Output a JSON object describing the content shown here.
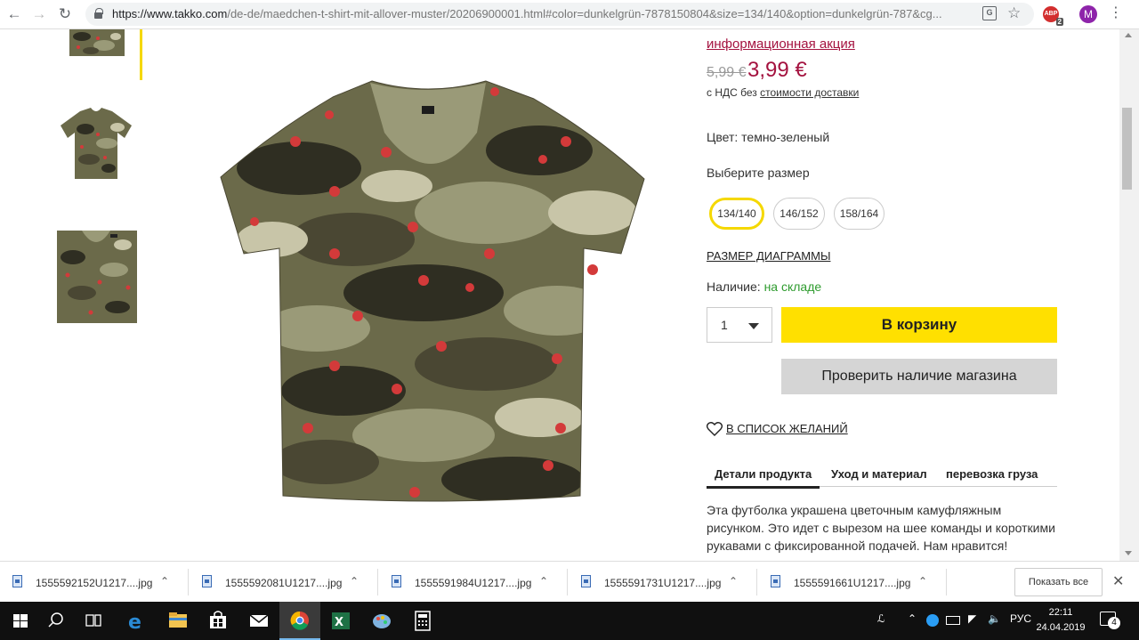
{
  "browser": {
    "url_host": "https://www.takko.com",
    "url_path": "/de-de/maedchen-t-shirt-mit-allover-muster/20206900001.html#color=dunkelgrün-7878150804&size=134/140&option=dunkelgrün-787&cg...",
    "ext_badge": "2",
    "ext_label": "ABP",
    "profile_initial": "M"
  },
  "product": {
    "promo_link": "информационная акция",
    "old_price": "5,99 €",
    "new_price": "3,99 €",
    "vat_prefix": "с НДС без",
    "vat_link": "стоимости доставки",
    "color_line": "Цвет: темно-зеленый",
    "size_title": "Выберите размер",
    "sizes": [
      "134/140",
      "146/152",
      "158/164"
    ],
    "size_chart_link": "РАЗМЕР ДИАГРАММЫ",
    "availability_label": "Наличие:",
    "availability_value": "на складе",
    "quantity": "1",
    "add_to_cart": "В корзину",
    "check_store": "Проверить наличие магазина",
    "wishlist": "В СПИСОК ЖЕЛАНИЙ",
    "tabs": [
      "Детали продукта",
      "Уход и материал",
      "перевозка груза"
    ],
    "description": "Эта футболка украшена цветочным камуфляжным рисунком. Это идет с вырезом на шее команды и короткими рукавами с фиксированной подачей. Нам нравится!"
  },
  "downloads": {
    "files": [
      "1555592152U1217....jpg",
      "1555592081U1217....jpg",
      "1555591984U1217....jpg",
      "1555591731U1217....jpg",
      "1555591661U1217....jpg"
    ],
    "show_all": "Показать все"
  },
  "taskbar": {
    "lang": "РУС",
    "time": "22:11",
    "date": "24.04.2019",
    "notifications": "4"
  },
  "colors": {
    "accent_yellow": "#ffe000",
    "price_red": "#a4123f",
    "stock_green": "#2e9b2e",
    "camo": [
      "#6b6a4a",
      "#9a9a78",
      "#4a4733",
      "#2f2e22",
      "#c8c5a8",
      "#d33a3a"
    ]
  }
}
